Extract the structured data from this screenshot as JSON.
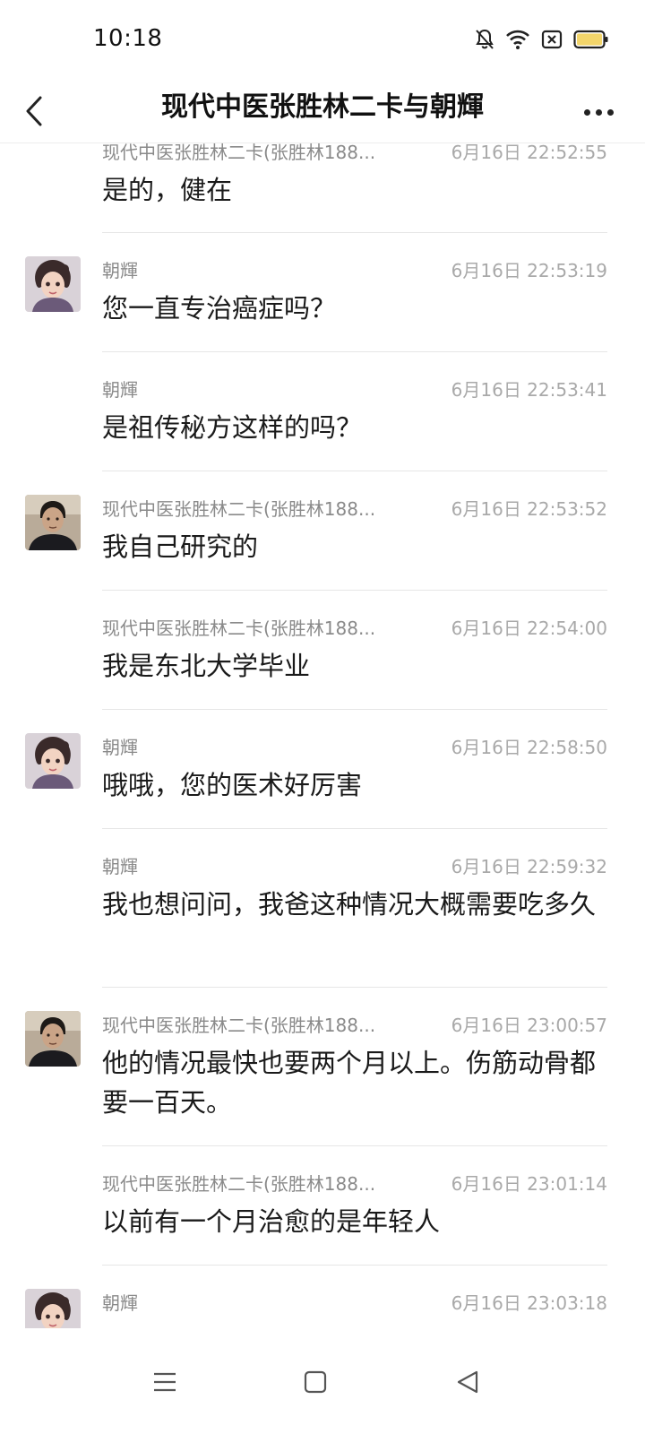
{
  "status_bar": {
    "time": "10:18",
    "icons": [
      "bell-muted-icon",
      "wifi-icon",
      "sim-blocked-icon",
      "battery-icon"
    ],
    "battery_color": "#f2d56b"
  },
  "header": {
    "title": "现代中医张胜林二卡与朝輝",
    "back_icon": "chevron-left-icon",
    "more_icon": "more-dots-icon"
  },
  "messages": [
    {
      "sender": "现代中医张胜林二卡(张胜林188...",
      "time": "6月16日 22:52:55",
      "text": "是的，健在",
      "avatar": "none"
    },
    {
      "sender": "朝輝",
      "time": "6月16日 22:53:19",
      "text": "您一直专治癌症吗？",
      "avatar": "cartoon-girl"
    },
    {
      "sender": "朝輝",
      "time": "6月16日 22:53:41",
      "text": "是祖传秘方这样的吗？",
      "avatar": "none"
    },
    {
      "sender": "现代中医张胜林二卡(张胜林188...",
      "time": "6月16日 22:53:52",
      "text": "我自己研究的",
      "avatar": "man-photo"
    },
    {
      "sender": "现代中医张胜林二卡(张胜林188...",
      "time": "6月16日 22:54:00",
      "text": "我是东北大学毕业",
      "avatar": "none"
    },
    {
      "sender": "朝輝",
      "time": "6月16日 22:58:50",
      "text": "哦哦，您的医术好厉害",
      "avatar": "cartoon-girl"
    },
    {
      "sender": "朝輝",
      "time": "6月16日 22:59:32",
      "text": "我也想问问，我爸这种情况大概需要吃多久",
      "avatar": "none"
    },
    {
      "sender": "现代中医张胜林二卡(张胜林188...",
      "time": "6月16日 23:00:57",
      "text": "他的情况最快也要两个月以上。伤筋动骨都要一百天。",
      "avatar": "man-photo"
    },
    {
      "sender": "现代中医张胜林二卡(张胜林188...",
      "time": "6月16日 23:01:14",
      "text": "以前有一个月治愈的是年轻人",
      "avatar": "none"
    },
    {
      "sender": "朝輝",
      "time": "6月16日 23:03:18",
      "text": "",
      "avatar": "cartoon-girl"
    }
  ],
  "system_nav": {
    "icons": [
      "menu-icon",
      "home-square-icon",
      "back-triangle-icon"
    ]
  }
}
